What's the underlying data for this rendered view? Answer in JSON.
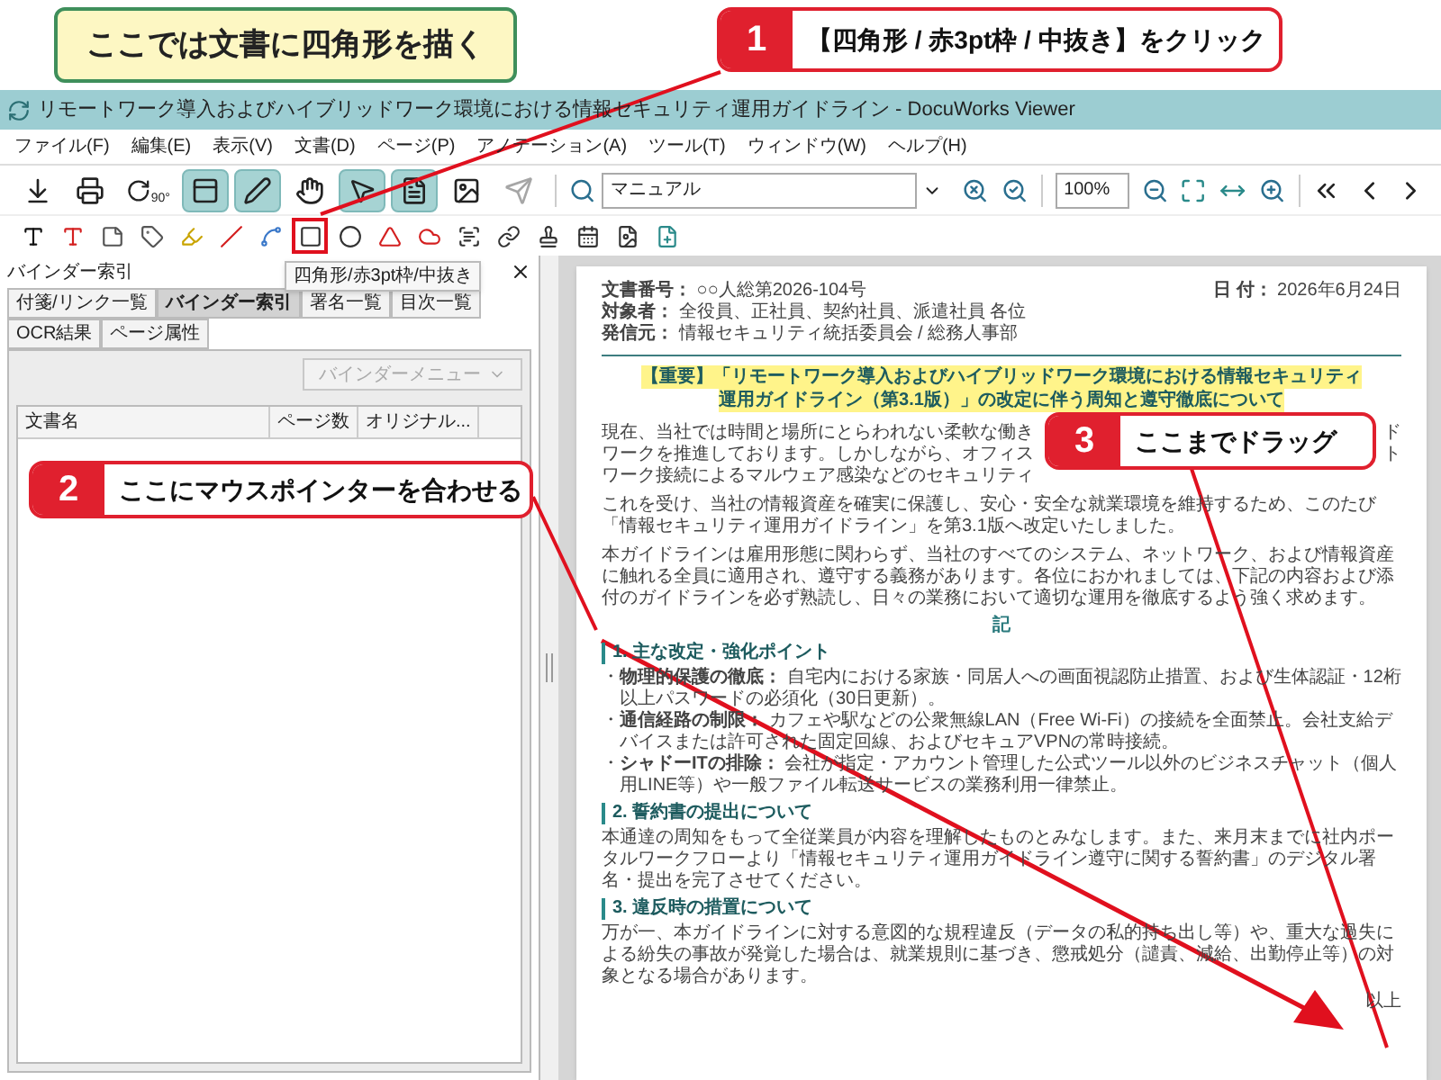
{
  "instruction_banner": {
    "text": "ここでは文書に四角形を描く"
  },
  "callouts": [
    {
      "number": "1",
      "text": "【四角形 / 赤3pt枠 / 中抜き】をクリック"
    },
    {
      "number": "2",
      "text": "ここにマウスポインターを合わせる"
    },
    {
      "number": "3",
      "text": "ここまでドラッグ"
    }
  ],
  "window": {
    "title": "リモートワーク導入およびハイブリッドワーク環境における情報セキュリティ運用ガイドライン - DocuWorks Viewer"
  },
  "menu": [
    "ファイル(F)",
    "編集(E)",
    "表示(V)",
    "文書(D)",
    "ページ(P)",
    "アノテーション(A)",
    "ツール(T)",
    "ウィンドウ(W)",
    "ヘルプ(H)"
  ],
  "toolbar": {
    "tools": [
      {
        "kind": "save",
        "selected": false,
        "disabled": false
      },
      {
        "kind": "print",
        "selected": false,
        "disabled": false
      },
      {
        "kind": "rotate",
        "label": "90°",
        "selected": false,
        "disabled": false
      },
      {
        "kind": "info",
        "selected": true,
        "disabled": false
      },
      {
        "kind": "pen",
        "selected": true,
        "disabled": false
      },
      {
        "kind": "hand",
        "selected": false,
        "disabled": false
      },
      {
        "kind": "select",
        "selected": true,
        "disabled": false
      },
      {
        "kind": "page",
        "selected": true,
        "disabled": false
      },
      {
        "kind": "image",
        "selected": false,
        "disabled": false
      },
      {
        "kind": "send",
        "selected": false,
        "disabled": true
      }
    ],
    "search_field": {
      "value": "マニュアル"
    },
    "zoom_field": {
      "value": "100%"
    }
  },
  "annotation_tools": {
    "tooltip": "四角形/赤3pt枠/中抜き",
    "items": [
      {
        "kind": "text",
        "selected": false
      },
      {
        "kind": "colortext",
        "selected": false
      },
      {
        "kind": "sticky",
        "selected": false
      },
      {
        "kind": "tag",
        "selected": false
      },
      {
        "kind": "marker",
        "selected": false
      },
      {
        "kind": "line",
        "selected": false
      },
      {
        "kind": "polyline",
        "selected": false
      },
      {
        "kind": "rectangle",
        "selected": true
      },
      {
        "kind": "ellipse",
        "selected": false
      },
      {
        "kind": "bowtie",
        "selected": false
      },
      {
        "kind": "cloud",
        "selected": false
      },
      {
        "kind": "ocr",
        "selected": false
      },
      {
        "kind": "link",
        "selected": false
      },
      {
        "kind": "seal",
        "selected": false
      },
      {
        "kind": "date",
        "selected": false
      },
      {
        "kind": "pageimage",
        "selected": false
      },
      {
        "kind": "addpage",
        "selected": false
      }
    ]
  },
  "binder_panel": {
    "title": "バインダー索引",
    "tabs": [
      {
        "label": "付箋/リンク一覧",
        "selected": false
      },
      {
        "label": "バインダー索引",
        "selected": true
      },
      {
        "label": "署名一覧",
        "selected": false
      },
      {
        "label": "目次一覧",
        "selected": false
      },
      {
        "label": "OCR結果",
        "selected": false
      },
      {
        "label": "ページ属性",
        "selected": false
      }
    ],
    "menu_button": {
      "label": "バインダーメニュー",
      "disabled": true
    },
    "columns": [
      "文書名",
      "ページ数",
      "オリジナル..."
    ]
  },
  "document": {
    "meta": [
      "**文書番号：** ○○人総第2026-104号",
      "**日 付：** 2026年6月24日",
      "**対象者：** 全役員、正社員、契約社員、派遣社員 各位",
      "**発信元：** 情報セキュリティ統括委員会 / 総務人事部"
    ],
    "title": [
      "【重要】「リモートワーク導入およびハイブリッドワーク環境における情報セキュリティ",
      "運用ガイドライン（第3.1版）」の改定に伴う周知と遵守徹底について"
    ],
    "intro_lines": [
      {
        "left": "現在、当社では時間と場所にとらわれない柔軟な働き",
        "right": "ド"
      },
      {
        "left": "ワークを推進しております。しかしながら、オフィス",
        "right": "ト"
      },
      {
        "left": "ワーク接続によるマルウェア感染などのセキュリティ"
      }
    ],
    "paragraphs": [
      "これを受け、当社の情報資産を確実に保護し、安心・安全な就業環境を維持するため、このたび「情報セキュリティ運用ガイドライン」を第3.1版へ改定いたしました。",
      "本ガイドラインは雇用形態に関わらず、当社のすべてのシステム、ネットワーク、および情報資産に触れる全員に適用され、遵守する義務があります。各位におかれましては、下記の内容および添付のガイドラインを必ず熟読し、日々の業務において適切な運用を徹底するよう強く求めます。"
    ],
    "note_mark": "記",
    "sections": [
      {
        "heading": "1. 主な改定・強化ポイント",
        "bullets": [
          {
            "marker": "・",
            "text": "**物理的保護の徹底：** 自宅内における家族・同居人への画面視認防止措置、および生体認証・12桁以上パスワードの必須化（30日更新）。"
          },
          {
            "marker": "・",
            "text": "**通信経路の制限：** カフェや駅などの公衆無線LAN（Free Wi-Fi）の接続を全面禁止。会社支給デバイスまたは許可された固定回線、およびセキュアVPNの常時接続。"
          },
          {
            "marker": "・",
            "text": "**シャドーITの排除：** 会社が指定・アカウント管理した公式ツール以外のビジネスチャット（個人用LINE等）や一般ファイル転送サービスの業務利用一律禁止。"
          }
        ]
      },
      {
        "heading": "2. 誓約書の提出について",
        "paragraphs": [
          "本通達の周知をもって全従業員が内容を理解したものとみなします。また、来月末までに社内ポータルワークフローより「情報セキュリティ運用ガイドライン遵守に関する誓約書」のデジタル署名・提出を完了させてください。"
        ]
      },
      {
        "heading": "3. 違反時の措置について",
        "paragraphs": [
          "万が一、本ガイドラインに対する意図的な規程違反（データの私的持ち出し等）や、重大な過失による紛失の事故が発覚した場合は、就業規則に基づき、懲戒処分（譴責、減給、出勤停止等）の対象となる場合があります。"
        ]
      }
    ],
    "closing": "以上"
  }
}
